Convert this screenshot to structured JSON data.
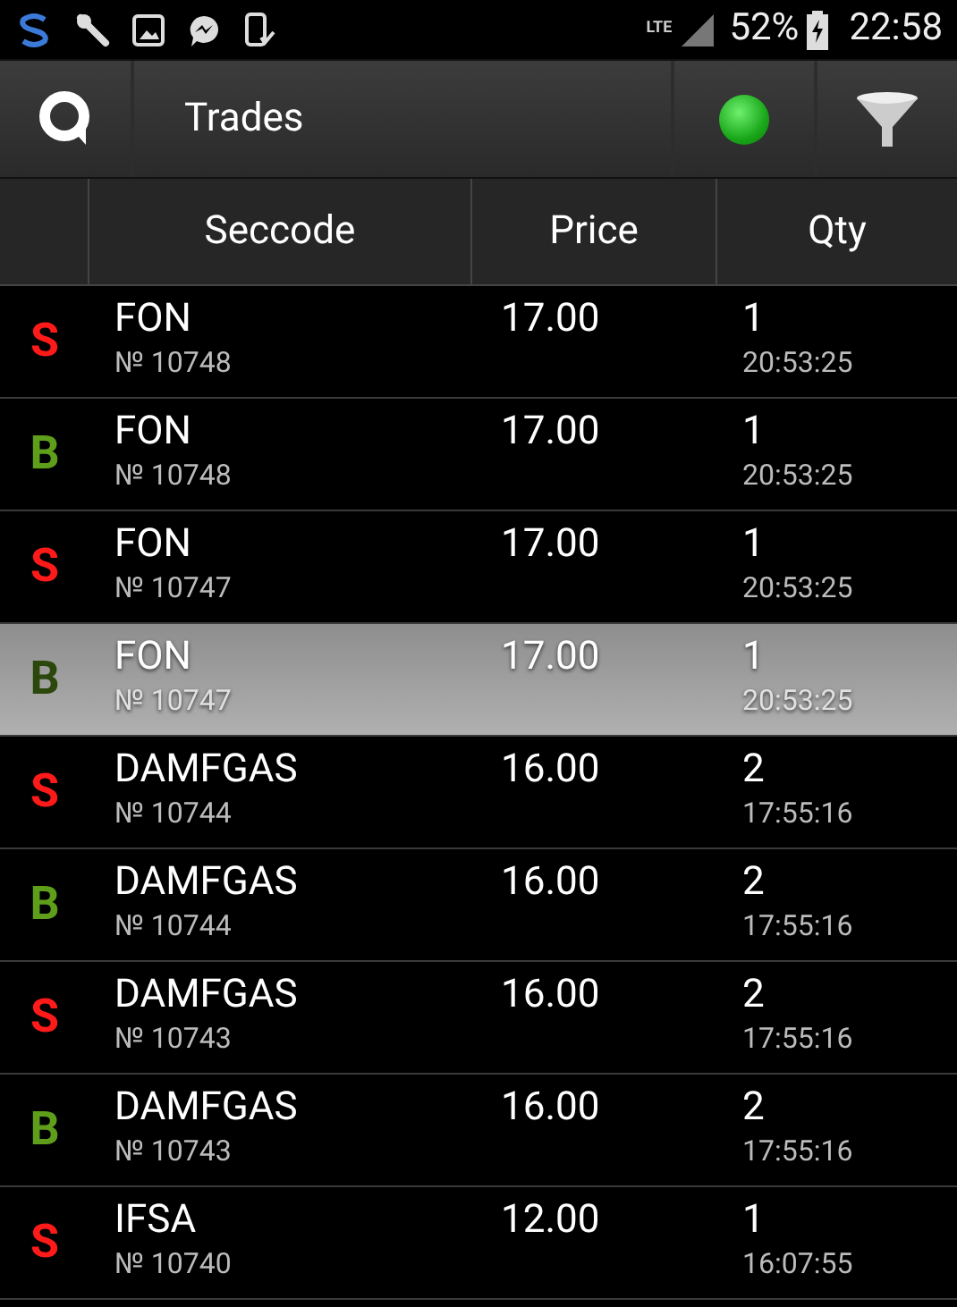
{
  "status_bar": {
    "network": "LTE",
    "battery": "52%",
    "time": "22:58"
  },
  "toolbar": {
    "title": "Trades",
    "connected": true
  },
  "table": {
    "columns": [
      "Seccode",
      "Price",
      "Qty"
    ],
    "rows": [
      {
        "side": "S",
        "kind": "sell",
        "seccode": "FON",
        "number": "№ 10748",
        "price": "17.00",
        "qty": "1",
        "time": "20:53:25",
        "selected": false
      },
      {
        "side": "B",
        "kind": "buy",
        "seccode": "FON",
        "number": "№ 10748",
        "price": "17.00",
        "qty": "1",
        "time": "20:53:25",
        "selected": false
      },
      {
        "side": "S",
        "kind": "sell",
        "seccode": "FON",
        "number": "№ 10747",
        "price": "17.00",
        "qty": "1",
        "time": "20:53:25",
        "selected": false
      },
      {
        "side": "B",
        "kind": "buy",
        "seccode": "FON",
        "number": "№ 10747",
        "price": "17.00",
        "qty": "1",
        "time": "20:53:25",
        "selected": true
      },
      {
        "side": "S",
        "kind": "sell",
        "seccode": "DAMFGAS",
        "number": "№ 10744",
        "price": "16.00",
        "qty": "2",
        "time": "17:55:16",
        "selected": false
      },
      {
        "side": "B",
        "kind": "buy",
        "seccode": "DAMFGAS",
        "number": "№ 10744",
        "price": "16.00",
        "qty": "2",
        "time": "17:55:16",
        "selected": false
      },
      {
        "side": "S",
        "kind": "sell",
        "seccode": "DAMFGAS",
        "number": "№ 10743",
        "price": "16.00",
        "qty": "2",
        "time": "17:55:16",
        "selected": false
      },
      {
        "side": "B",
        "kind": "buy",
        "seccode": "DAMFGAS",
        "number": "№ 10743",
        "price": "16.00",
        "qty": "2",
        "time": "17:55:16",
        "selected": false
      },
      {
        "side": "S",
        "kind": "sell",
        "seccode": "IFSA",
        "number": "№ 10740",
        "price": "12.00",
        "qty": "1",
        "time": "16:07:55",
        "selected": false
      }
    ]
  }
}
